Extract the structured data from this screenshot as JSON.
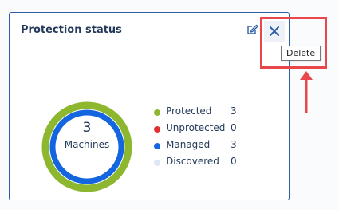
{
  "widget": {
    "title": "Protection status",
    "edit_icon": "edit-icon",
    "close_icon": "close-icon",
    "tooltip": "Delete"
  },
  "donut": {
    "count": "3",
    "label": "Machines"
  },
  "legend": [
    {
      "label": "Protected",
      "value": "3",
      "color": "#8db72f"
    },
    {
      "label": "Unprotected",
      "value": "0",
      "color": "#e22f2f"
    },
    {
      "label": "Managed",
      "value": "3",
      "color": "#1466e0"
    },
    {
      "label": "Discovered",
      "value": "0",
      "color": "#dde6f4"
    }
  ],
  "colors": {
    "protected": "#8db72f",
    "managed": "#1466e0",
    "annotation": "#e8474c",
    "border": "#2f5ea8"
  }
}
